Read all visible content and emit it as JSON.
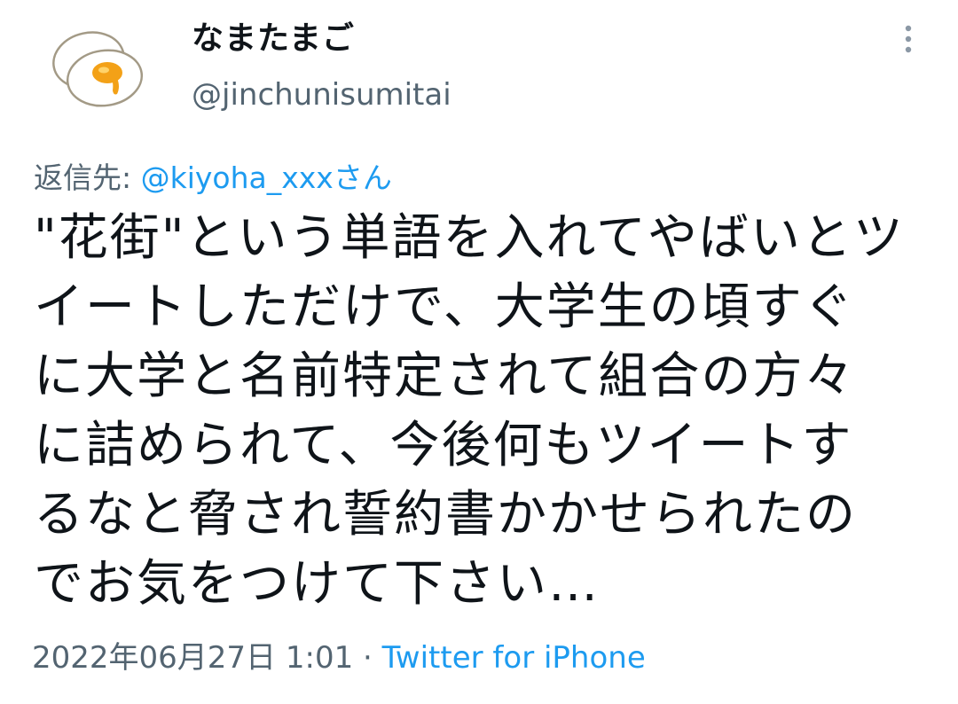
{
  "author": {
    "display_name": "なまたまご",
    "handle": "@jinchunisumitai",
    "avatar_icon": "boiled-egg-icon"
  },
  "reply": {
    "prefix": "返信先: ",
    "mention": "@kiyoha_xxx",
    "suffix": "さん"
  },
  "tweet": {
    "lines": [
      "\"花街\"という単語を入れてやばいとツ",
      "イートしただけで、大学生の頃すぐ",
      "に大学と名前特定されて組合の方々",
      "に詰められて、今後何もツイートす",
      "るなと脅され誓約書かかせられたの",
      "でお気をつけて下さい…"
    ]
  },
  "meta": {
    "timestamp": "2022年06月27日 1:01",
    "separator": " · ",
    "source": "Twitter for iPhone"
  },
  "colors": {
    "text": "#0f1419",
    "secondary": "#536471",
    "link": "#1d9bf0"
  }
}
